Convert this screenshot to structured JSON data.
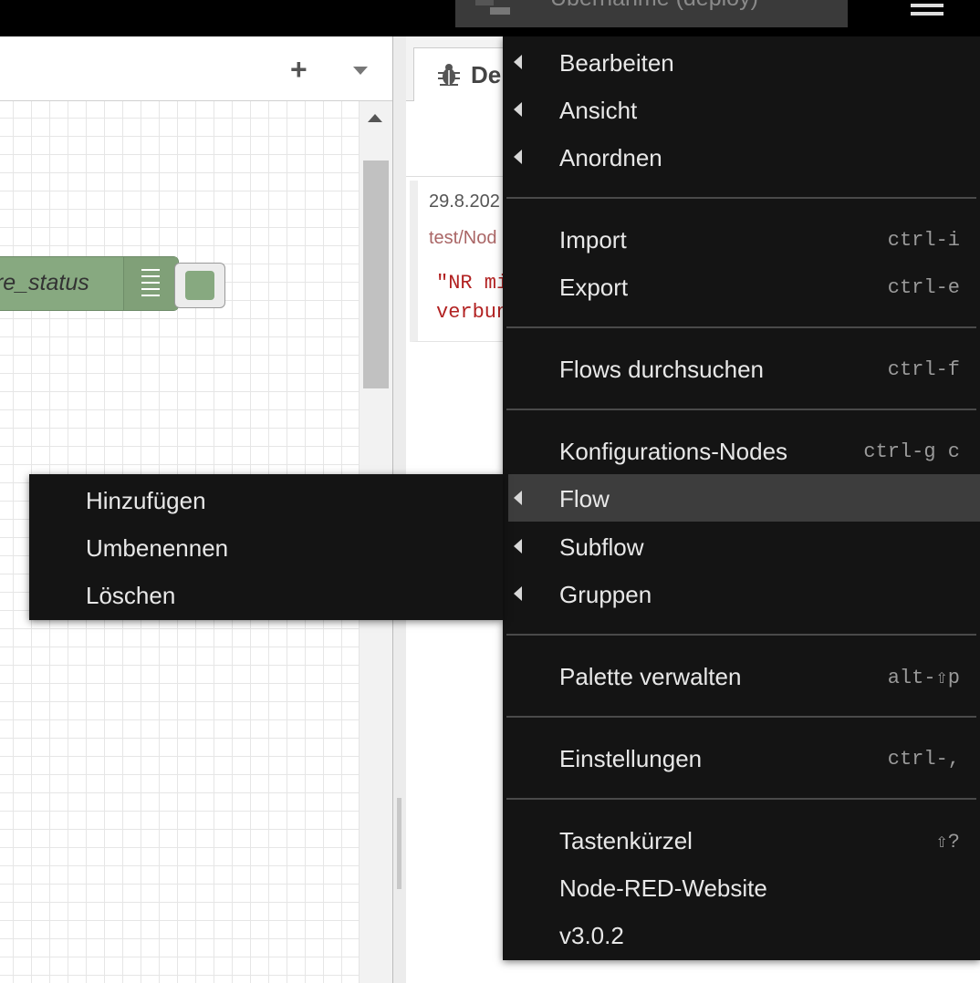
{
  "header": {
    "deploy_label": "Übernahme (deploy)"
  },
  "workspace": {
    "add_tab_symbol": "+",
    "node_label": "ure_status"
  },
  "sidebar": {
    "debug_tab_label": "De",
    "message": {
      "date": "29.8.202",
      "topic": "test/Nod",
      "payload": "\"NR mi\nverbun"
    }
  },
  "main_menu": {
    "items": [
      {
        "label": "Bearbeiten",
        "submenu": true,
        "shortcut": ""
      },
      {
        "label": "Ansicht",
        "submenu": true,
        "shortcut": ""
      },
      {
        "label": "Anordnen",
        "submenu": true,
        "shortcut": ""
      },
      {
        "label": "Import",
        "submenu": false,
        "shortcut": "ctrl-i"
      },
      {
        "label": "Export",
        "submenu": false,
        "shortcut": "ctrl-e"
      },
      {
        "label": "Flows durchsuchen",
        "submenu": false,
        "shortcut": "ctrl-f"
      },
      {
        "label": "Konfigurations-Nodes",
        "submenu": false,
        "shortcut": "ctrl-g c"
      },
      {
        "label": "Flow",
        "submenu": true,
        "shortcut": "",
        "active": true
      },
      {
        "label": "Subflow",
        "submenu": true,
        "shortcut": ""
      },
      {
        "label": "Gruppen",
        "submenu": true,
        "shortcut": ""
      },
      {
        "label": "Palette verwalten",
        "submenu": false,
        "shortcut": "alt-⇧p"
      },
      {
        "label": "Einstellungen",
        "submenu": false,
        "shortcut": "ctrl-,"
      },
      {
        "label": "Tastenkürzel",
        "submenu": false,
        "shortcut": "⇧?"
      },
      {
        "label": "Node-RED-Website",
        "submenu": false,
        "shortcut": ""
      },
      {
        "label": "v3.0.2",
        "submenu": false,
        "shortcut": ""
      }
    ]
  },
  "flow_submenu": {
    "items": [
      {
        "label": "Hinzufügen"
      },
      {
        "label": "Umbenennen"
      },
      {
        "label": "Löschen"
      }
    ]
  },
  "colors": {
    "menu_background": "#141414",
    "menu_active": "#3d3d3d",
    "node_color": "#87a980",
    "payload_color": "#b22222"
  }
}
